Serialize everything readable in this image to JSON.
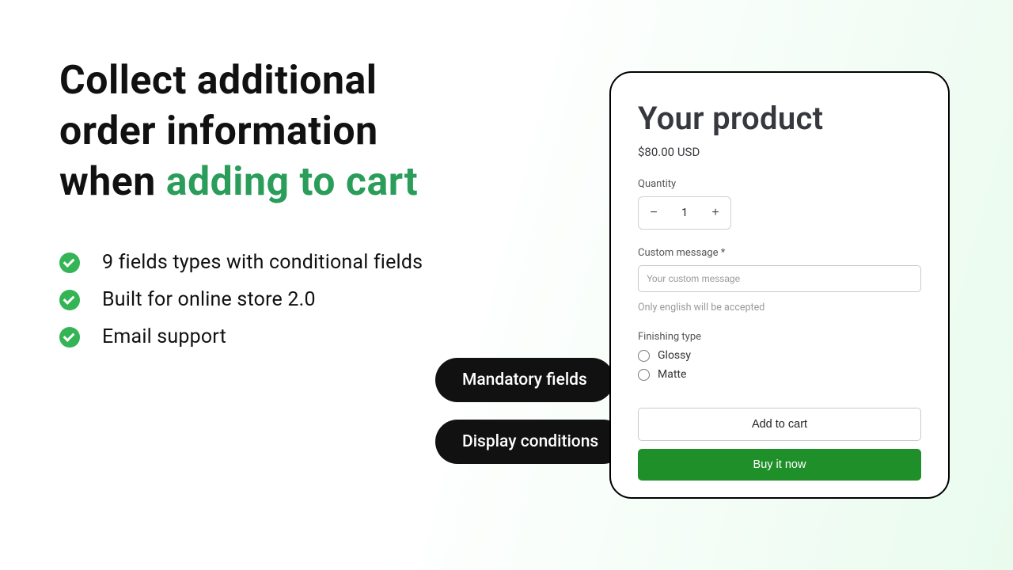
{
  "hero": {
    "line1": "Collect additional",
    "line2": "order information",
    "line3_prefix": "when ",
    "line3_highlight": "adding to cart"
  },
  "bullets": [
    "9 fields types with conditional fields",
    "Built for online store 2.0",
    "Email support"
  ],
  "pills": {
    "mandatory": "Mandatory fields",
    "display": "Display conditions"
  },
  "product": {
    "title": "Your product",
    "price": "$80.00 USD",
    "quantity_label": "Quantity",
    "quantity_value": "1",
    "custom_msg_label": "Custom message *",
    "custom_msg_placeholder": "Your custom message",
    "custom_msg_hint": "Only english will be accepted",
    "finishing_label": "Finishing type",
    "finishing_options": {
      "glossy": "Glossy",
      "matte": "Matte"
    },
    "add_to_cart": "Add to cart",
    "buy_now": "Buy it now"
  }
}
